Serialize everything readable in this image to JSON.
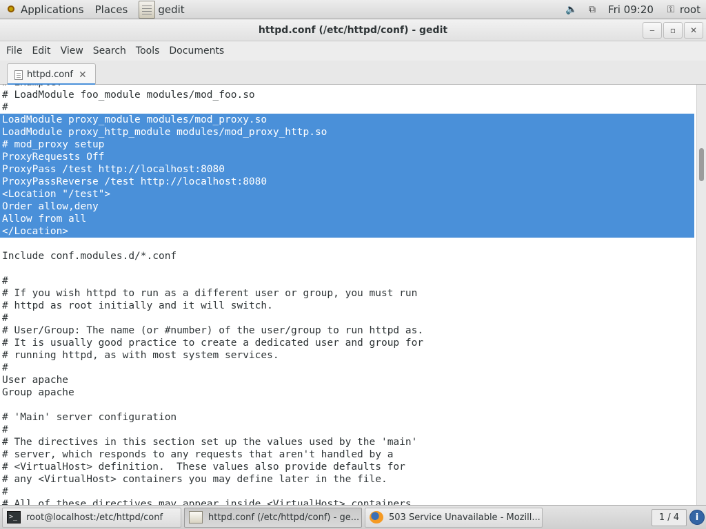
{
  "top_panel": {
    "applications": "Applications",
    "places": "Places",
    "active_app": "gedit",
    "clock": "Fri 09:20",
    "user": "root"
  },
  "window": {
    "title": "httpd.conf (/etc/httpd/conf) - gedit",
    "buttons": {
      "minimize": "‒",
      "maximize": "▫",
      "close": "✕"
    }
  },
  "menu": [
    "File",
    "Edit",
    "View",
    "Search",
    "Tools",
    "Documents"
  ],
  "tab": {
    "label": "httpd.conf",
    "close": "✕"
  },
  "editor": {
    "lines": [
      "# Example:",
      "# LoadModule foo_module modules/mod_foo.so",
      "#",
      "LoadModule proxy_module modules/mod_proxy.so",
      "LoadModule proxy_http_module modules/mod_proxy_http.so",
      "# mod_proxy setup",
      "ProxyRequests Off",
      "ProxyPass /test http://localhost:8080",
      "ProxyPassReverse /test http://localhost:8080",
      "<Location \"/test\">",
      "Order allow,deny",
      "Allow from all",
      "</Location>",
      "",
      "Include conf.modules.d/*.conf",
      "",
      "#",
      "# If you wish httpd to run as a different user or group, you must run",
      "# httpd as root initially and it will switch.",
      "#",
      "# User/Group: The name (or #number) of the user/group to run httpd as.",
      "# It is usually good practice to create a dedicated user and group for",
      "# running httpd, as with most system services.",
      "#",
      "User apache",
      "Group apache",
      "",
      "# 'Main' server configuration",
      "#",
      "# The directives in this section set up the values used by the 'main'",
      "# server, which responds to any requests that aren't handled by a",
      "# <VirtualHost> definition.  These values also provide defaults for",
      "# any <VirtualHost> containers you may define later in the file.",
      "#",
      "# All of these directives may appear inside <VirtualHost> containers,"
    ],
    "selected_from": 3,
    "selected_to": 12
  },
  "taskbar": {
    "tasks": [
      "root@localhost:/etc/httpd/conf",
      "httpd.conf (/etc/httpd/conf) - ge...",
      "503 Service Unavailable - Mozill..."
    ],
    "workspace": "1 / 4",
    "info": "i"
  },
  "colors": {
    "selection": "#4a90d9",
    "selection_text": "#ffffff"
  }
}
